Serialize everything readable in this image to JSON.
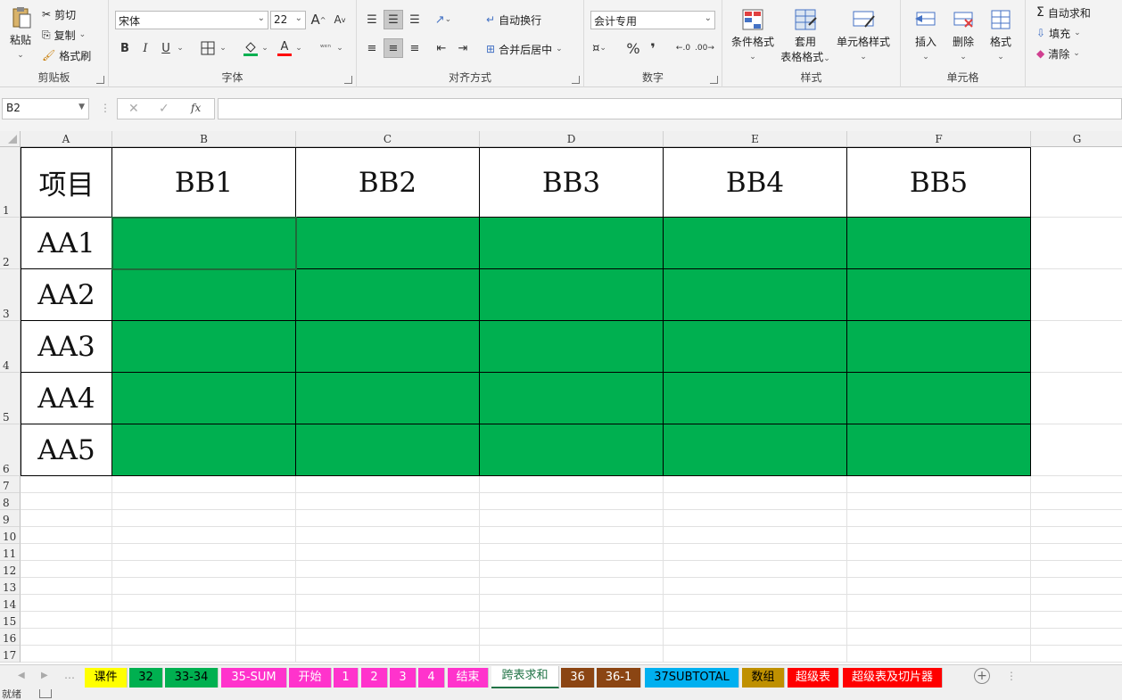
{
  "ribbon": {
    "clipboard": {
      "label": "剪贴板",
      "paste": "粘贴",
      "cut": "剪切",
      "copy": "复制",
      "painter": "格式刷"
    },
    "font": {
      "label": "字体",
      "name": "宋体",
      "size": "22",
      "bold": "B",
      "italic": "I",
      "underline": "U",
      "grow": "A",
      "shrink": "A",
      "fontcolor": "A"
    },
    "alignment": {
      "label": "对齐方式",
      "wrap": "自动换行",
      "merge": "合并后居中"
    },
    "number": {
      "label": "数字",
      "format": "会计专用",
      "percent": "%",
      "comma": "❜"
    },
    "styles": {
      "label": "样式",
      "cond": "条件格式",
      "table_1": "套用",
      "table_2": "表格格式",
      "cell": "单元格样式"
    },
    "cells": {
      "label": "单元格",
      "insert": "插入",
      "delete": "删除",
      "format": "格式"
    },
    "editing": {
      "autosum": "自动求和",
      "fill": "填充",
      "clear": "清除"
    }
  },
  "formula_bar": {
    "name_box": "B2",
    "fx": "fx",
    "value": ""
  },
  "columns": [
    "A",
    "B",
    "C",
    "D",
    "E",
    "F",
    "G"
  ],
  "rows": [
    "1",
    "2",
    "3",
    "4",
    "5",
    "6",
    "7",
    "8",
    "9",
    "10",
    "11",
    "12",
    "13",
    "14",
    "15",
    "16",
    "17"
  ],
  "table": {
    "corner": "项目",
    "headers": [
      "BB1",
      "BB2",
      "BB3",
      "BB4",
      "BB5"
    ],
    "row_labels": [
      "AA1",
      "AA2",
      "AA3",
      "AA4",
      "AA5"
    ],
    "fill_color": "#00b050"
  },
  "sheet_tabs": [
    {
      "label": "课件",
      "color": "#ffff00",
      "text": "#000000"
    },
    {
      "label": "32",
      "color": "#00b050",
      "text": "#000000"
    },
    {
      "label": "33-34",
      "color": "#00b050",
      "text": "#000000"
    },
    {
      "label": "35-SUM",
      "color": "#ff33cc",
      "text": "#ffffff"
    },
    {
      "label": "开始",
      "color": "#ff33cc",
      "text": "#ffffff"
    },
    {
      "label": "1",
      "color": "#ff33cc",
      "text": "#ffffff"
    },
    {
      "label": "2",
      "color": "#ff33cc",
      "text": "#ffffff"
    },
    {
      "label": "3",
      "color": "#ff33cc",
      "text": "#ffffff"
    },
    {
      "label": "4",
      "color": "#ff33cc",
      "text": "#ffffff"
    },
    {
      "label": "结束",
      "color": "#ff33cc",
      "text": "#ffffff"
    },
    {
      "label": "跨表求和",
      "color": "#ffffff",
      "text": "#217346"
    },
    {
      "label": "36",
      "color": "#8b4513",
      "text": "#ffffff"
    },
    {
      "label": "36-1",
      "color": "#8b4513",
      "text": "#ffffff"
    },
    {
      "label": "37SUBTOTAL",
      "color": "#00b0f0",
      "text": "#000000"
    },
    {
      "label": "数组",
      "color": "#bf9000",
      "text": "#000000"
    },
    {
      "label": "超级表",
      "color": "#ff0000",
      "text": "#ffffff"
    },
    {
      "label": "超级表及切片器",
      "color": "#ff0000",
      "text": "#ffffff"
    }
  ],
  "status": {
    "ready": "就绪"
  }
}
